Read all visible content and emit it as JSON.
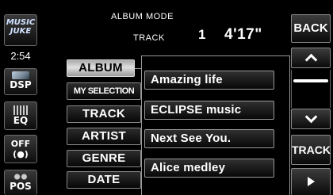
{
  "header": {
    "mode_label": "ALBUM MODE",
    "track_label": "TRACK",
    "track_number": "1",
    "time": "4'17\""
  },
  "left": {
    "music_juke_line1": "MUSIC",
    "music_juke_line2": "JUKE",
    "clock": "2:54",
    "dsp_label": "DSP",
    "eq_label": "EQ",
    "off_label": "OFF",
    "pos_label": "POS"
  },
  "menu": [
    {
      "label": "ALBUM",
      "active": true
    },
    {
      "label": "MY SELECTION",
      "active": false
    },
    {
      "label": "TRACK",
      "active": false
    },
    {
      "label": "ARTIST",
      "active": false
    },
    {
      "label": "GENRE",
      "active": false
    },
    {
      "label": "DATE",
      "active": false
    }
  ],
  "list": [
    "Amazing life",
    "ECLIPSE music",
    "Next See You.",
    "Alice medley"
  ],
  "right": {
    "back_label": "BACK",
    "track_label": "TRACK"
  },
  "colors": {
    "background": "#000000",
    "button_text": "#ffffff",
    "active_button": "#d8d8d8"
  }
}
